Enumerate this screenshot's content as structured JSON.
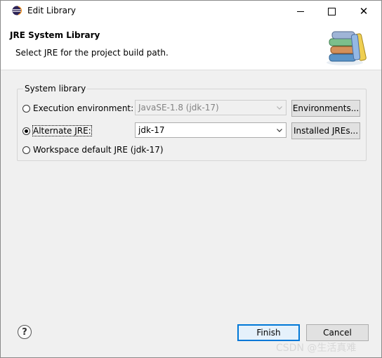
{
  "window": {
    "title": "Edit Library",
    "controls": {
      "minimize": "minimize",
      "maximize": "maximize",
      "close": "✕"
    }
  },
  "banner": {
    "title": "JRE System Library",
    "description": "Select JRE for the project build path."
  },
  "group": {
    "label": "System library",
    "options": [
      {
        "label": "Execution environment:",
        "selected": false
      },
      {
        "label": "Alternate JRE:",
        "selected": true
      },
      {
        "label": "Workspace default JRE (jdk-17)",
        "selected": false
      }
    ],
    "exec_env_combo": {
      "value": "JavaSE-1.8 (jdk-17)",
      "enabled": false
    },
    "alt_jre_combo": {
      "value": "jdk-17",
      "enabled": true
    },
    "environments_button": "Environments...",
    "installed_jres_button": "Installed JREs..."
  },
  "footer": {
    "help_label": "?",
    "finish_label": "Finish",
    "cancel_label": "Cancel"
  },
  "watermark": "CSDN @生活真难",
  "colors": {
    "accent": "#0078d7",
    "dialog_bg": "#f0f0f0",
    "button_bg": "#e1e1e1"
  }
}
